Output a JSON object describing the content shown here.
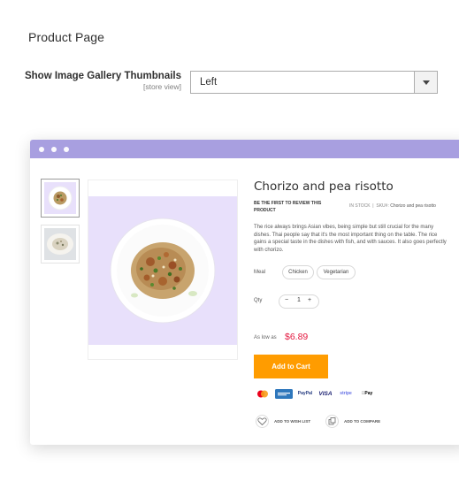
{
  "section": {
    "title": "Product Page"
  },
  "setting": {
    "label": "Show Image Gallery Thumbnails",
    "scope": "[store view]",
    "value": "Left"
  },
  "preview": {
    "product_title": "Chorizo and pea risotto",
    "review_link": "BE THE FIRST TO REVIEW THIS PRODUCT",
    "stock": "IN STOCK",
    "sku_label": "SKU#:",
    "sku_value": "Chorizo and pea risotto",
    "description": "The rice always brings Asian vibes, being simple but still crucial for the many dishes. Thai people say that it's the most important thing on the table. The rice gains a special taste in the dishes with fish, and with sauces. It also goes perfectly with chorizo.",
    "meal_label": "Meal",
    "meal_options": [
      "Chicken",
      "Vegetarian"
    ],
    "qty_label": "Qty",
    "qty": {
      "minus": "−",
      "value": "1",
      "plus": "+"
    },
    "price_label": "As low as",
    "price": "$6.89",
    "add_to_cart": "Add to Cart",
    "payments": [
      "PayPal",
      "VISA",
      "stripe",
      "Pay"
    ],
    "wishlist": "ADD TO WISH LIST",
    "compare": "ADD TO COMPARE"
  },
  "colors": {
    "titlebar": "#a89fe0",
    "image_bg": "#e8e0fb",
    "price": "#e3173e",
    "cart_button": "#ff9c00"
  },
  "icons": [
    "mastercard-icon",
    "amex-icon",
    "heart-icon",
    "compare-icon",
    "chevron-down-icon"
  ]
}
